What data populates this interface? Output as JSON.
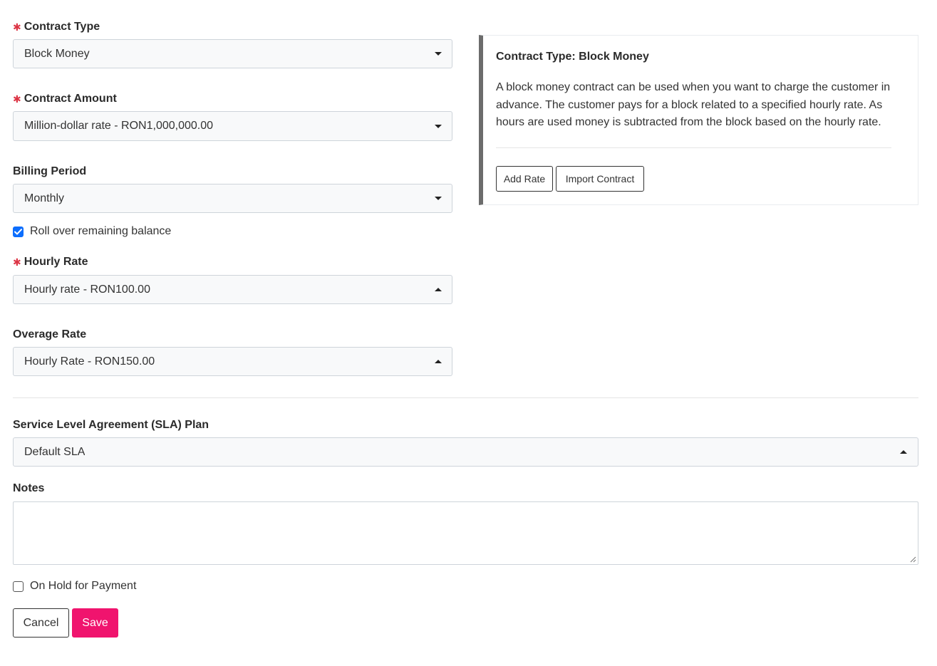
{
  "contract_type": {
    "label": "Contract Type",
    "required": true,
    "value": "Block Money"
  },
  "contract_amount": {
    "label": "Contract Amount",
    "required": true,
    "value": "Million-dollar rate - RON1,000,000.00"
  },
  "billing_period": {
    "label": "Billing Period",
    "value": "Monthly"
  },
  "rollover": {
    "label": "Roll over remaining balance",
    "checked": true
  },
  "hourly_rate": {
    "label": "Hourly Rate",
    "required": true,
    "value": "Hourly rate - RON100.00"
  },
  "overage_rate": {
    "label": "Overage Rate",
    "value": "Hourly Rate - RON150.00"
  },
  "info_panel": {
    "title": "Contract Type: Block Money",
    "description": "A block money contract can be used when you want to charge the customer in advance. The customer pays for a block related to a specified hourly rate. As hours are used money is subtracted from the block based on the hourly rate.",
    "add_rate_label": "Add Rate",
    "import_contract_label": "Import Contract"
  },
  "sla_plan": {
    "label": "Service Level Agreement (SLA) Plan",
    "value": "Default SLA"
  },
  "notes": {
    "label": "Notes",
    "value": ""
  },
  "on_hold": {
    "label": "On Hold for Payment",
    "checked": false
  },
  "actions": {
    "cancel_label": "Cancel",
    "save_label": "Save"
  },
  "colors": {
    "accent": "#f0146e",
    "checkbox": "#0d6efd",
    "required": "#dc3545"
  },
  "icons": {
    "required": "asterisk-icon",
    "dropdown_closed": "caret-down-icon",
    "dropdown_open": "caret-up-icon",
    "check": "check-icon"
  }
}
